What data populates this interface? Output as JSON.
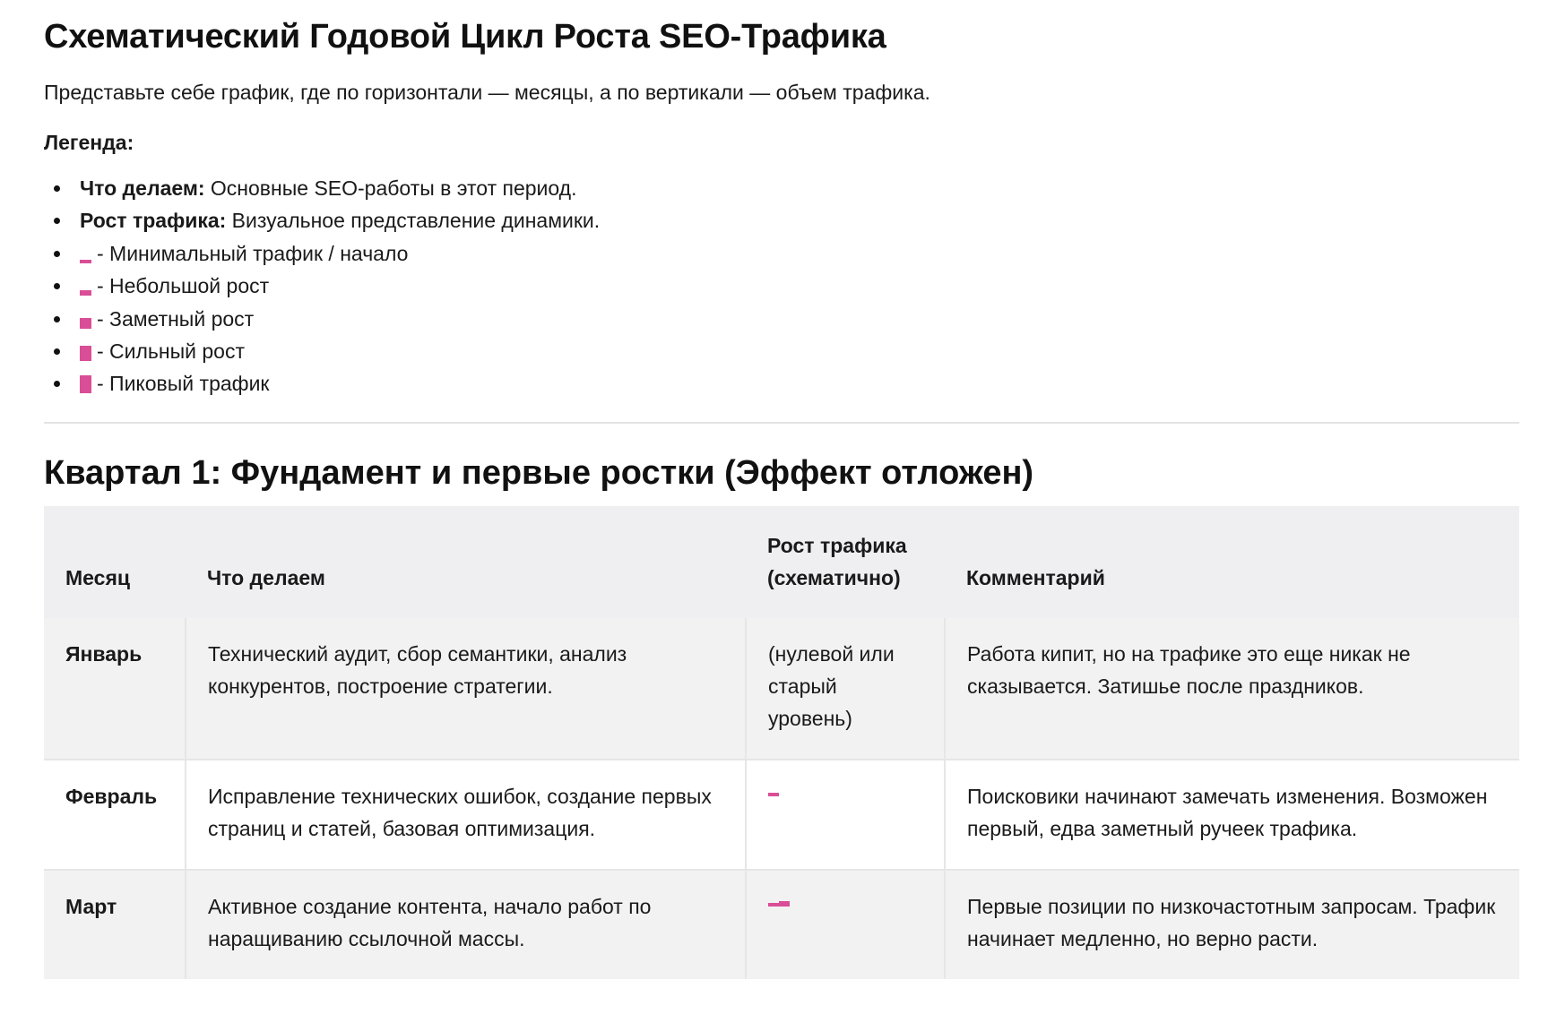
{
  "title": "Схематический Годовой Цикл Роста SEO-Трафика",
  "intro": "Представьте себе график, где по горизонтали — месяцы, а по вертикали — объем трафика.",
  "legend": {
    "heading": "Легенда:",
    "items": [
      {
        "label": "Что делаем:",
        "text": " Основные SEO-работы в этот период."
      },
      {
        "label": "Рост трафика:",
        "text": " Визуальное представление динамики."
      }
    ],
    "levels": [
      {
        "text": "- Минимальный трафик / начало",
        "level": 1
      },
      {
        "text": "- Небольшой рост",
        "level": 2
      },
      {
        "text": "- Заметный рост",
        "level": 3
      },
      {
        "text": "- Сильный рост",
        "level": 4
      },
      {
        "text": "- Пиковый трафик",
        "level": 5
      }
    ],
    "bar_color": "#d94e96"
  },
  "quarter1": {
    "title": "Квартал 1: Фундамент и первые ростки (Эффект отложен)",
    "columns": [
      "Месяц",
      "Что делаем",
      "Рост трафика (схематично)",
      "Комментарий"
    ],
    "rows": [
      {
        "month": "Январь",
        "what": "Технический аудит, сбор семантики, анализ конкурентов, построение стратегии.",
        "growth_text": "(нулевой или старый уровень)",
        "growth_levels": [],
        "comment": "Работа кипит, но на трафике это еще никак не сказывается. Затишье после праздников."
      },
      {
        "month": "Февраль",
        "what": "Исправление технических ошибок, создание первых страниц и статей, базовая оптимизация.",
        "growth_text": "",
        "growth_levels": [
          1
        ],
        "comment": "Поисковики начинают замечать изменения. Возможен первый, едва заметный ручеек трафика."
      },
      {
        "month": "Март",
        "what": "Активное создание контента, начало работ по наращиванию ссылочной массы.",
        "growth_text": "",
        "growth_levels": [
          1,
          2
        ],
        "comment": "Первые позиции по низкочастотным запросам. Трафик начинает медленно, но верно расти."
      }
    ]
  }
}
